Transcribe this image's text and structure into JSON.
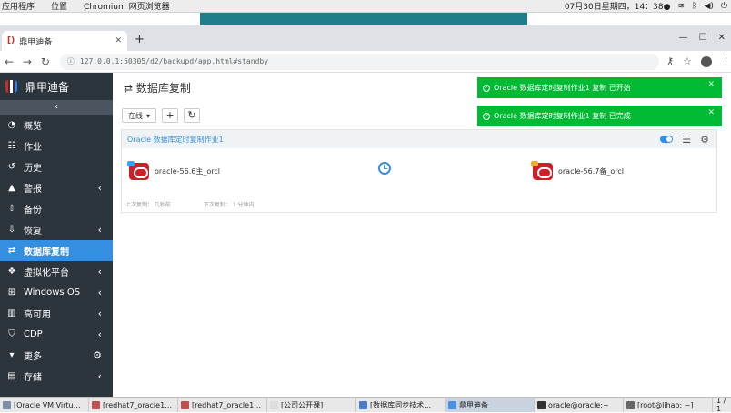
{
  "os_top": {
    "menus": [
      "应用程序",
      "位置",
      "Chromium 网页浏览器"
    ],
    "datetime": "07月30日星期四，14：38●"
  },
  "browser": {
    "tab_title": "鼎甲迪备",
    "url": "127.0.0.1:50305/d2/backupd/app.html#standby"
  },
  "sidebar": {
    "brand": "鼎甲迪备",
    "items": [
      {
        "label": "概览",
        "icon": "dashboard-icon",
        "chev": false
      },
      {
        "label": "作业",
        "icon": "list-icon",
        "chev": false
      },
      {
        "label": "历史",
        "icon": "history-icon",
        "chev": false
      },
      {
        "label": "警报",
        "icon": "alert-icon",
        "chev": true
      },
      {
        "label": "备份",
        "icon": "upload-icon",
        "chev": false
      },
      {
        "label": "恢复",
        "icon": "download-icon",
        "chev": true
      },
      {
        "label": "数据库复制",
        "icon": "swap-icon",
        "chev": false,
        "active": true
      },
      {
        "label": "虚拟化平台",
        "icon": "cubes-icon",
        "chev": true
      },
      {
        "label": "Windows OS",
        "icon": "windows-icon",
        "chev": true
      },
      {
        "label": "高可用",
        "icon": "columns-icon",
        "chev": true
      },
      {
        "label": "CDP",
        "icon": "shield-icon",
        "chev": true
      },
      {
        "label": "更多",
        "icon": "caret-down-icon",
        "chev": false,
        "gear": true
      },
      {
        "label": "存储",
        "icon": "storage-icon",
        "chev": true
      }
    ]
  },
  "main": {
    "title": "数据库复制",
    "filter": "在线",
    "card": {
      "title": "Oracle 数据库定时复制作业1",
      "source": "oracle-56.6主_orcl",
      "target": "oracle-56.7备_orcl",
      "last_copy": "上次复制： 几秒前",
      "next_copy": "下次复制： 1 分钟内"
    }
  },
  "toasts": [
    "Oracle 数据库定时复制作业1 复制 已开始",
    "Oracle 数据库定时复制作业1 复制 已完成"
  ],
  "taskbar": {
    "items": [
      {
        "label": "[Oracle VM Virtu…",
        "color": "#7b8fa6"
      },
      {
        "label": "[redhat7_oracle1…",
        "color": "#c0504d"
      },
      {
        "label": "[redhat7_oracle1…",
        "color": "#c0504d"
      },
      {
        "label": "[公司公开课]",
        "color": "#ddd"
      },
      {
        "label": "[数据库同步技术…",
        "color": "#4a7bd0"
      },
      {
        "label": "鼎甲迪备",
        "color": "#4a90e2",
        "active": true
      },
      {
        "label": "oracle@oracle:~",
        "color": "#333"
      },
      {
        "label": "[root@lihao: ~]",
        "color": "#666"
      }
    ],
    "pager": "1 / 1"
  },
  "colors": {
    "sidebar": "#2d353c",
    "active": "#348fe2",
    "toast": "#00ba34"
  }
}
